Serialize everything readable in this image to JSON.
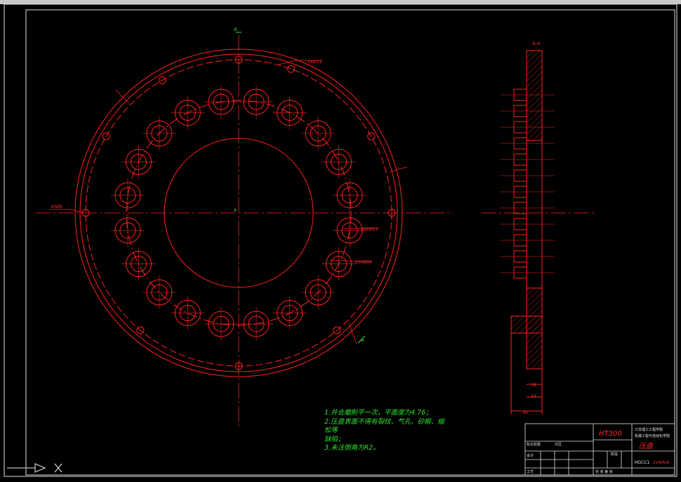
{
  "drawing": {
    "section_label": "A-A",
    "view_marker_top": "A",
    "view_marker_center": "A",
    "view_marker_bottom": "A",
    "dim_hole_top": "4XØ11",
    "dim_hole_left": "4XØ8",
    "dim_bolt_circle_1": "20XØ21",
    "dim_bolt_circle_2": "20XØ24",
    "dim_side_small": "38",
    "dim_side_mid": "24",
    "dim_side_bottom": "40"
  },
  "notes": {
    "line1": "1.并合磨削平一次，平面度为4.76；",
    "line2": "2.压盘表面不得有裂纹、气孔、砂眼、缩松等",
    "line3": "缺陷；",
    "line4": "3.未注倒角为R2。"
  },
  "title_block": {
    "material": "HT300",
    "school": "江苏理工工程学院",
    "dept": "机械工程与自动化学院",
    "part_name": "压盘",
    "drawing_no": "HGCC1",
    "drawing_no_suffix": "2x4/A-A",
    "row_a": "标记处数",
    "row_b": "分区",
    "row_c": "设计",
    "row_d": "工艺",
    "row_e": "共  张  第  张",
    "stage": "阶段"
  }
}
